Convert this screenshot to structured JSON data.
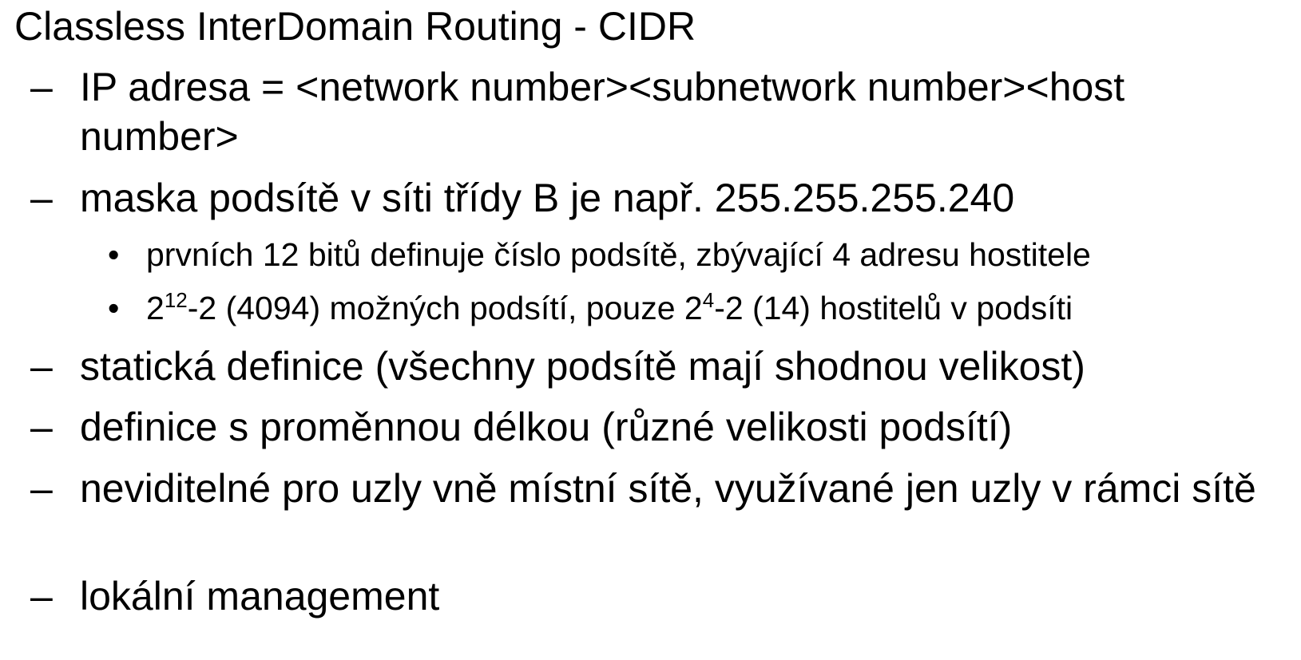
{
  "title": "Classless InterDomain Routing - CIDR",
  "bullet_dash": "–",
  "bullet_dot": "•",
  "items": [
    {
      "text": "IP adresa = <network number><subnetwork number><host number>"
    },
    {
      "text": "maska podsítě v síti třídy B je např. 255.255.255.240"
    },
    {
      "text": "statická definice (všechny podsítě mají shodnou velikost)"
    },
    {
      "text": "definice s proměnnou délkou (různé velikosti podsítí)"
    },
    {
      "text": "neviditelné pro uzly vně místní sítě, využívané jen uzly v rámci sítě"
    },
    {
      "text": "lokální management"
    }
  ],
  "subitems": [
    {
      "text": "prvních 12 bitů definuje číslo podsítě, zbývající 4 adresu hostitele"
    },
    {
      "base1": "2",
      "exp1": "12",
      "mid": "-2 (4094) možných podsítí, pouze 2",
      "exp2": "4",
      "tail": "-2 (14) hostitelů v podsíti"
    }
  ]
}
